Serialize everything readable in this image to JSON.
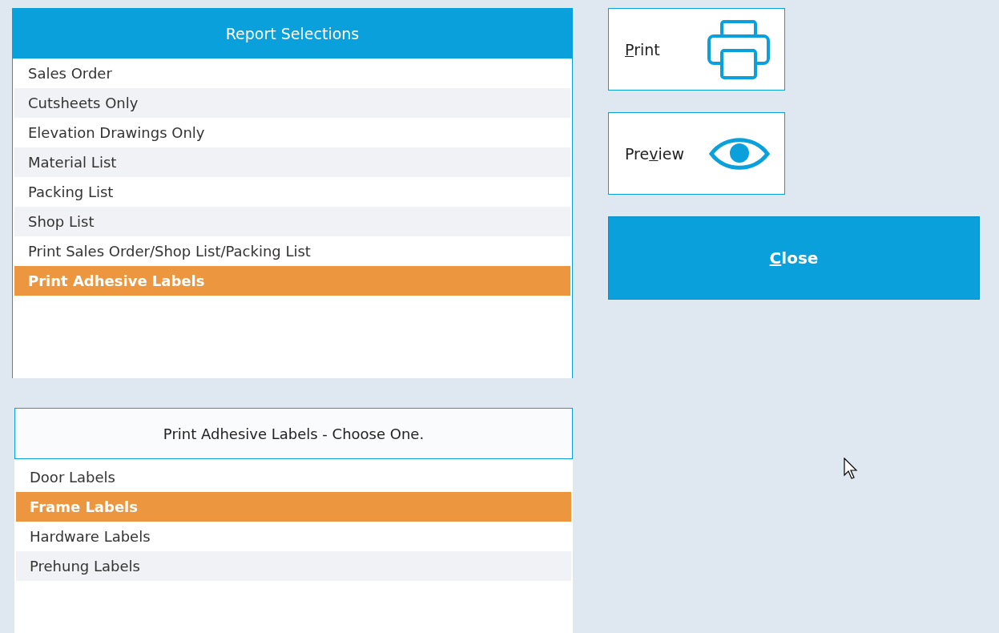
{
  "report_selections": {
    "title": "Report Selections",
    "items": [
      {
        "label": "Sales Order",
        "selected": false
      },
      {
        "label": "Cutsheets Only",
        "selected": false
      },
      {
        "label": "Elevation Drawings Only",
        "selected": false
      },
      {
        "label": "Material List",
        "selected": false
      },
      {
        "label": "Packing List",
        "selected": false
      },
      {
        "label": "Shop List",
        "selected": false
      },
      {
        "label": "Print Sales Order/Shop List/Packing List",
        "selected": false
      },
      {
        "label": "Print Adhesive Labels",
        "selected": true
      }
    ]
  },
  "label_choices": {
    "title": "Print Adhesive Labels - Choose One.",
    "items": [
      {
        "label": "Door Labels",
        "selected": false
      },
      {
        "label": "Frame Labels",
        "selected": true
      },
      {
        "label": "Hardware Labels",
        "selected": false
      },
      {
        "label": "Prehung Labels",
        "selected": false
      }
    ]
  },
  "buttons": [
    {
      "kind": "print",
      "access_key": "P",
      "after": "rint"
    },
    {
      "kind": "preview",
      "before": "Pre",
      "access_key": "v",
      "after": "iew"
    },
    {
      "kind": "close",
      "access_key": "C",
      "after": "lose"
    }
  ]
}
